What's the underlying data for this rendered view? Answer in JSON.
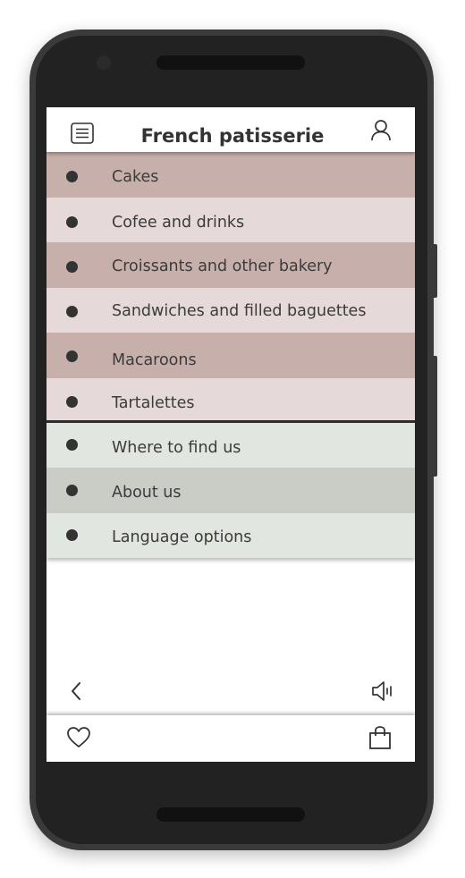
{
  "header": {
    "title": "French patisserie",
    "menu_icon": "hamburger-menu-icon",
    "user_icon": "user-icon"
  },
  "menu": {
    "categories": [
      {
        "label": "Cakes",
        "color": "#c7b0ab"
      },
      {
        "label": "Cofee and drinks",
        "color": "#e6d9d9"
      },
      {
        "label": "Croissants and other bakery",
        "color": "#c7b0ab"
      },
      {
        "label": "Sandwiches and filled baguettes",
        "color": "#e6d9d9"
      },
      {
        "label": "Macaroons",
        "color": "#c7b0ab"
      },
      {
        "label": "Tartalettes",
        "color": "#e6d9d9"
      }
    ],
    "info": [
      {
        "label": "Where to find us",
        "color": "#e2e6e0"
      },
      {
        "label": "About us",
        "color": "#c9cdc6"
      },
      {
        "label": "Language options",
        "color": "#e2e6e0"
      }
    ]
  },
  "navigation": {
    "back_icon": "chevron-left-icon",
    "sound_icon": "speaker-icon"
  },
  "bottom_bar": {
    "favorites_icon": "heart-icon",
    "cart_icon": "shopping-bag-icon"
  }
}
